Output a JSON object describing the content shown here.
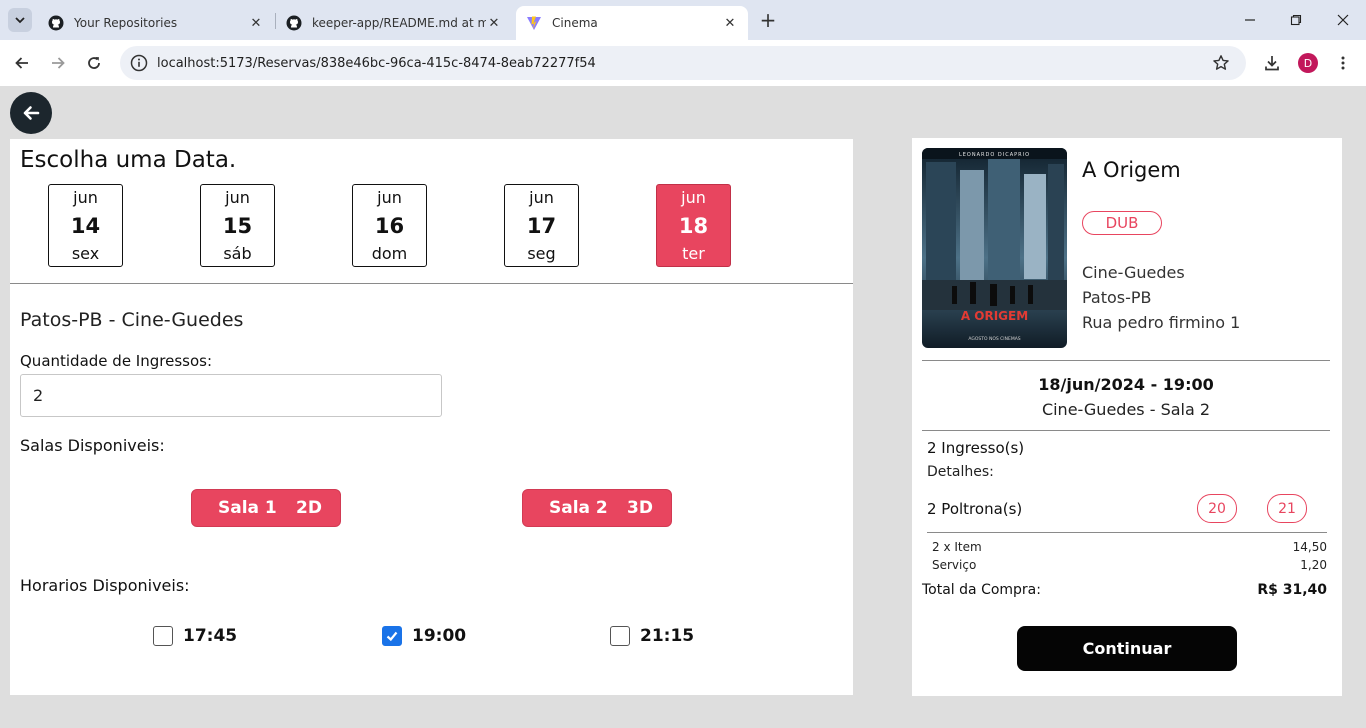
{
  "browser": {
    "tabs": [
      {
        "title": "Your Repositories",
        "favicon": "github-icon",
        "active": false
      },
      {
        "title": "keeper-app/README.md at ma",
        "favicon": "github-icon",
        "active": false
      },
      {
        "title": "Cinema",
        "favicon": "vite-icon",
        "active": true
      }
    ],
    "url": "localhost:5173/Reservas/838e46bc-96ca-415c-8474-8eab72277f54",
    "profile_initial": "D",
    "profile_color": "#c2185b"
  },
  "booking": {
    "date_heading": "Escolha uma Data.",
    "dates": [
      {
        "month": "jun",
        "day": "14",
        "weekday": "sex",
        "selected": false
      },
      {
        "month": "jun",
        "day": "15",
        "weekday": "sáb",
        "selected": false
      },
      {
        "month": "jun",
        "day": "16",
        "weekday": "dom",
        "selected": false
      },
      {
        "month": "jun",
        "day": "17",
        "weekday": "seg",
        "selected": false
      },
      {
        "month": "jun",
        "day": "18",
        "weekday": "ter",
        "selected": true
      }
    ],
    "cinema_name": "Patos-PB - Cine-Guedes",
    "quantity_label": "Quantidade de Ingressos:",
    "quantity_value": "2",
    "rooms_label": "Salas Disponiveis:",
    "rooms": [
      {
        "name": "Sala 1",
        "format": "2D"
      },
      {
        "name": "Sala 2",
        "format": "3D"
      }
    ],
    "times_label": "Horarios Disponiveis:",
    "times": [
      {
        "time": "17:45",
        "checked": false
      },
      {
        "time": "19:00",
        "checked": true
      },
      {
        "time": "21:15",
        "checked": false
      }
    ]
  },
  "summary": {
    "poster_title": "A ORIGEM",
    "poster_actor": "LEONARDO DICAPRIO",
    "poster_footer": "AGOSTO NOS CINEMAS",
    "movie_title": "A Origem",
    "badge": "DUB",
    "cinema": "Cine-Guedes",
    "city": "Patos-PB",
    "address": "Rua pedro firmino 1",
    "session_datetime": "18/jun/2024 - 19:00",
    "session_room": "Cine-Guedes - Sala 2",
    "tickets": "2 Ingresso(s)",
    "details_label": "Detalhes:",
    "seats_label": "2 Poltrona(s)",
    "seats": [
      "20",
      "21"
    ],
    "items": [
      {
        "label": "2 x Item",
        "value": "14,50"
      },
      {
        "label": "Serviço",
        "value": "1,20"
      }
    ],
    "total_label": "Total da Compra:",
    "total_value": "R$ 31,40",
    "continue_label": "Continuar"
  },
  "colors": {
    "accent": "#e8455f",
    "dark_button": "#050505",
    "back_button": "#1c262d"
  }
}
